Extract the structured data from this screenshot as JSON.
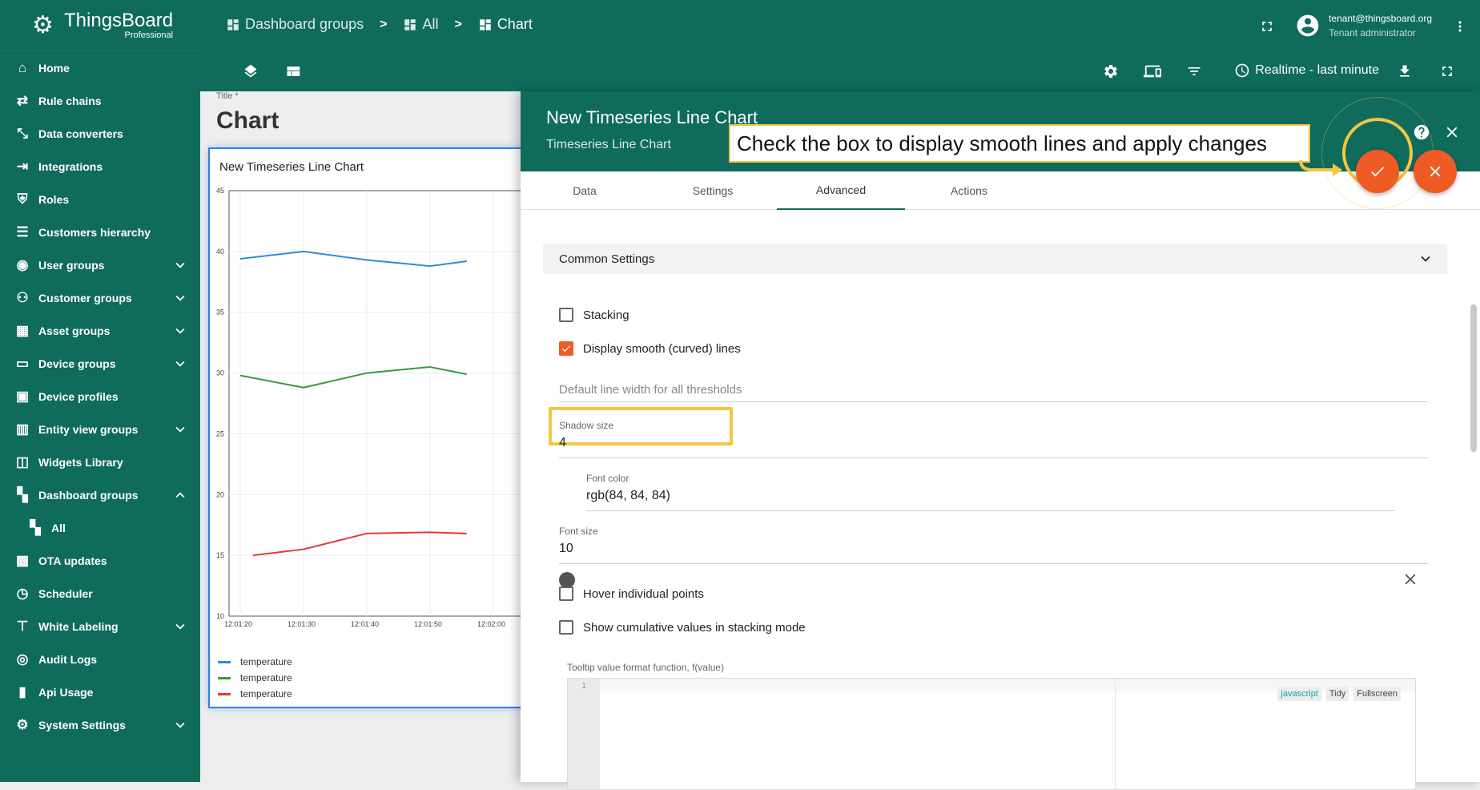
{
  "app": {
    "logo_title": "ThingsBoard",
    "logo_subtitle": "Professional"
  },
  "sidebar": {
    "items": [
      {
        "label": "Home",
        "icon": "home-icon"
      },
      {
        "label": "Rule chains",
        "icon": "code-arrows-icon"
      },
      {
        "label": "Data converters",
        "icon": "transform-icon"
      },
      {
        "label": "Integrations",
        "icon": "input-icon"
      },
      {
        "label": "Roles",
        "icon": "shield-icon"
      },
      {
        "label": "Customers hierarchy",
        "icon": "sort-lines-icon"
      },
      {
        "label": "User groups",
        "icon": "account-circle-icon",
        "expandable": true
      },
      {
        "label": "Customer groups",
        "icon": "supervisor-account-icon",
        "expandable": true
      },
      {
        "label": "Asset groups",
        "icon": "domain-icon",
        "expandable": true
      },
      {
        "label": "Device groups",
        "icon": "devices-icon",
        "expandable": true
      },
      {
        "label": "Device profiles",
        "icon": "device-profile-icon"
      },
      {
        "label": "Entity view groups",
        "icon": "view-quilt-icon",
        "expandable": true
      },
      {
        "label": "Widgets Library",
        "icon": "widgets-icon"
      },
      {
        "label": "Dashboard groups",
        "icon": "dashboard-icon",
        "expandable": true,
        "expanded": true
      },
      {
        "label": "All",
        "icon": "dashboard-icon",
        "sub": true
      },
      {
        "label": "OTA updates",
        "icon": "memory-icon"
      },
      {
        "label": "Scheduler",
        "icon": "schedule-icon"
      },
      {
        "label": "White Labeling",
        "icon": "format-paint-icon",
        "expandable": true
      },
      {
        "label": "Audit Logs",
        "icon": "track-changes-icon"
      },
      {
        "label": "Api Usage",
        "icon": "insert-chart-icon"
      },
      {
        "label": "System Settings",
        "icon": "settings-icon",
        "expandable": true
      }
    ]
  },
  "breadcrumb": {
    "items": [
      "Dashboard groups",
      "All",
      "Chart"
    ],
    "separator": ">"
  },
  "user": {
    "email": "tenant@thingsboard.org",
    "role": "Tenant administrator"
  },
  "toolbar": {
    "timewindow": "Realtime - last minute"
  },
  "dashboard": {
    "title_label": "Title *",
    "title": "Chart"
  },
  "widget": {
    "title": "New Timeseries Line Chart",
    "legend": [
      {
        "label": "temperature",
        "color": "#2f8ae0"
      },
      {
        "label": "temperature",
        "color": "#3a9a3a"
      },
      {
        "label": "temperature",
        "color": "#e53935"
      }
    ]
  },
  "chart_data": {
    "type": "line",
    "x": [
      "12:01:20",
      "12:01:30",
      "12:01:40",
      "12:01:50",
      "12:02:00"
    ],
    "ylim": [
      10,
      45
    ],
    "yticks": [
      10,
      15,
      20,
      25,
      30,
      35,
      40,
      45
    ],
    "grid": true,
    "legend_position": "bottom-left",
    "series": [
      {
        "name": "temperature",
        "color": "#2f8ae0",
        "points": [
          [
            0.0,
            39.4
          ],
          [
            1.0,
            40.0
          ],
          [
            2.0,
            39.3
          ],
          [
            3.0,
            38.8
          ],
          [
            3.58,
            39.2
          ]
        ]
      },
      {
        "name": "temperature",
        "color": "#3a9a3a",
        "points": [
          [
            0.0,
            29.8
          ],
          [
            1.0,
            28.8
          ],
          [
            2.0,
            30.0
          ],
          [
            3.0,
            30.5
          ],
          [
            3.58,
            29.9
          ]
        ]
      },
      {
        "name": "temperature",
        "color": "#e53935",
        "points": [
          [
            0.2,
            15.0
          ],
          [
            1.0,
            15.5
          ],
          [
            2.0,
            16.8
          ],
          [
            3.0,
            16.9
          ],
          [
            3.58,
            16.8
          ]
        ]
      }
    ]
  },
  "editor": {
    "title": "New Timeseries Line Chart",
    "subtitle": "Timeseries Line Chart",
    "tabs": [
      "Data",
      "Settings",
      "Advanced",
      "Actions"
    ],
    "active_tab": "Advanced",
    "section_title": "Common Settings",
    "stacking_label": "Stacking",
    "stacking_checked": false,
    "smooth_label": "Display smooth (curved) lines",
    "smooth_checked": true,
    "line_width_placeholder": "Default line width for all thresholds",
    "shadow_label": "Shadow size",
    "shadow_value": "4",
    "font_color_label": "Font color",
    "font_color_value": "rgb(84, 84, 84)",
    "font_size_label": "Font size",
    "font_size_value": "10",
    "hover_label": "Hover individual points",
    "cumulative_label": "Show cumulative values in stacking mode",
    "tooltip_fn_label": "Tooltip value format function, f(value)",
    "code_line_number": "1",
    "code_tools": [
      "javascript",
      "Tidy",
      "Fullscreen"
    ]
  },
  "callout": {
    "text": "Check the box to display smooth lines and apply changes"
  },
  "colors": {
    "primary": "#0f6b5c",
    "accent": "#ef5b25",
    "highlight": "#f4c542"
  }
}
